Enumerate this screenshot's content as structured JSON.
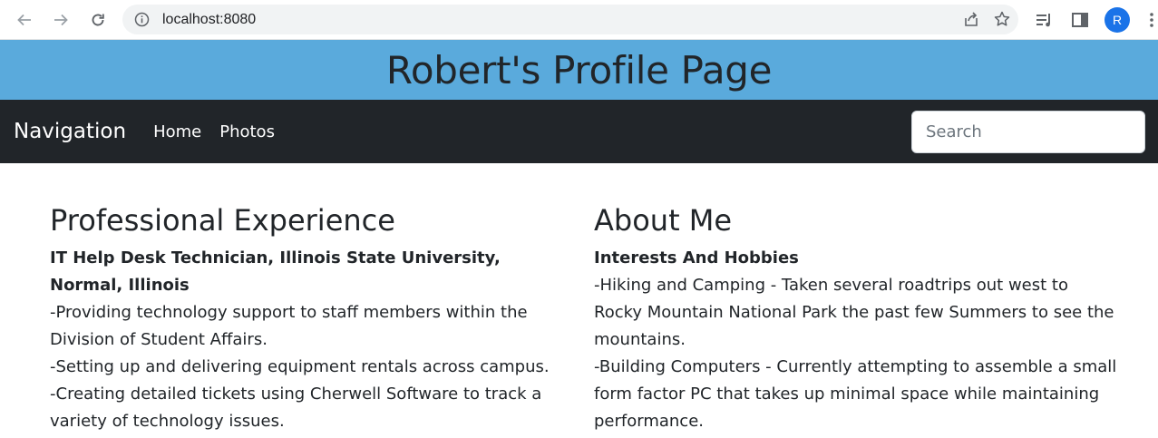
{
  "browser": {
    "url": "localhost:8080",
    "avatar_letter": "R",
    "colors": {
      "avatar": "#1a73e8",
      "omnibox": "#f1f3f4"
    }
  },
  "page": {
    "title": "Robert's Profile Page",
    "colors": {
      "banner": "#5aaadc",
      "navbar": "#212529"
    }
  },
  "navbar": {
    "brand": "Navigation",
    "links": [
      "Home",
      "Photos"
    ],
    "search_placeholder": "Search"
  },
  "experience": {
    "heading": "Professional Experience",
    "job_title": "IT Help Desk Technician, Illinois State University, Normal, Illinois",
    "lines": [
      "-Providing technology support to staff members within the Division of Student Affairs.",
      "-Setting up and delivering equipment rentals across campus.",
      "-Creating detailed tickets using Cherwell Software to track a variety of technology issues."
    ]
  },
  "about": {
    "heading": "About Me",
    "subheading": "Interests And Hobbies",
    "lines": [
      "-Hiking and Camping - Taken several roadtrips out west to Rocky Mountain National Park the past few Summers to see the mountains.",
      "-Building Computers - Currently attempting to assemble a small form factor PC that takes up minimal space while maintaining performance."
    ]
  }
}
